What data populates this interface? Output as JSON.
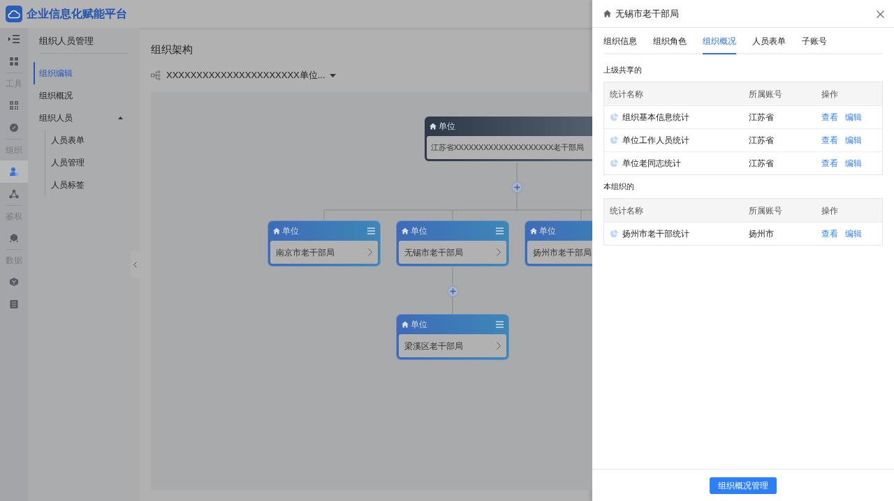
{
  "app": {
    "title": "企业信息化赋能平台"
  },
  "rail": [
    {
      "kind": "toggle"
    },
    {
      "kind": "icon",
      "selected": false
    },
    {
      "kind": "divider"
    },
    {
      "kind": "label",
      "label": "工具"
    },
    {
      "kind": "icon",
      "selected": false
    },
    {
      "kind": "icon",
      "selected": false
    },
    {
      "kind": "divider"
    },
    {
      "kind": "label",
      "label": "组织"
    },
    {
      "kind": "icon",
      "selected": true
    },
    {
      "kind": "icon",
      "selected": false
    },
    {
      "kind": "divider"
    },
    {
      "kind": "label",
      "label": "鉴权"
    },
    {
      "kind": "icon",
      "selected": false
    },
    {
      "kind": "divider"
    },
    {
      "kind": "label",
      "label": "数据"
    },
    {
      "kind": "icon",
      "selected": false
    },
    {
      "kind": "icon",
      "selected": false
    }
  ],
  "submenu": {
    "title": "组织人员管理",
    "items": [
      {
        "label": "组织编辑",
        "selected": true
      },
      {
        "label": "组织概况",
        "selected": false
      },
      {
        "label": "组织人员",
        "selected": false,
        "expanded": true,
        "children": [
          {
            "label": "人员表单",
            "selected": false
          },
          {
            "label": "人员管理",
            "selected": false
          },
          {
            "label": "人员标签",
            "selected": false
          }
        ]
      }
    ]
  },
  "main": {
    "title": "组织架构",
    "selector": "XXXXXXXXXXXXXXXXXXXXXX单位...",
    "org_chart": {
      "type_label": "单位",
      "name": "江苏省XXXXXXXXXXXXXXXXXXXX老干部局",
      "kind": "root",
      "children": [
        {
          "type_label": "单位",
          "name": "南京市老干部局",
          "kind": "unit"
        },
        {
          "type_label": "单位",
          "name": "无锡市老干部局",
          "kind": "unit",
          "children": [
            {
              "type_label": "单位",
              "name": "梁溪区老干部局",
              "kind": "unit"
            }
          ]
        },
        {
          "type_label": "单位",
          "name": "扬州市老干部局",
          "kind": "unit"
        }
      ]
    }
  },
  "drawer": {
    "title": "无锡市老干部局",
    "tabs": [
      {
        "label": "组织信息",
        "selected": false
      },
      {
        "label": "组织角色",
        "selected": false
      },
      {
        "label": "组织概况",
        "selected": true
      },
      {
        "label": "人员表单",
        "selected": false
      },
      {
        "label": "子账号",
        "selected": false
      }
    ],
    "sections": [
      {
        "title": "上级共享的",
        "columns": [
          "统计名称",
          "所属账号",
          "操作"
        ],
        "rows": [
          {
            "name": "组织基本信息统计",
            "account": "江苏省",
            "actions": [
              "查看",
              "编辑"
            ]
          },
          {
            "name": "单位工作人员统计",
            "account": "江苏省",
            "actions": [
              "查看",
              "编辑"
            ]
          },
          {
            "name": "单位老同志统计",
            "account": "江苏省",
            "actions": [
              "查看",
              "编辑"
            ]
          }
        ]
      },
      {
        "title": "本组织的",
        "columns": [
          "统计名称",
          "所属账号",
          "操作"
        ],
        "rows": [
          {
            "name": "扬州市老干部统计",
            "account": "扬州市",
            "actions": [
              "查看",
              "编辑"
            ]
          }
        ]
      }
    ],
    "footer_button": "组织概况管理"
  }
}
